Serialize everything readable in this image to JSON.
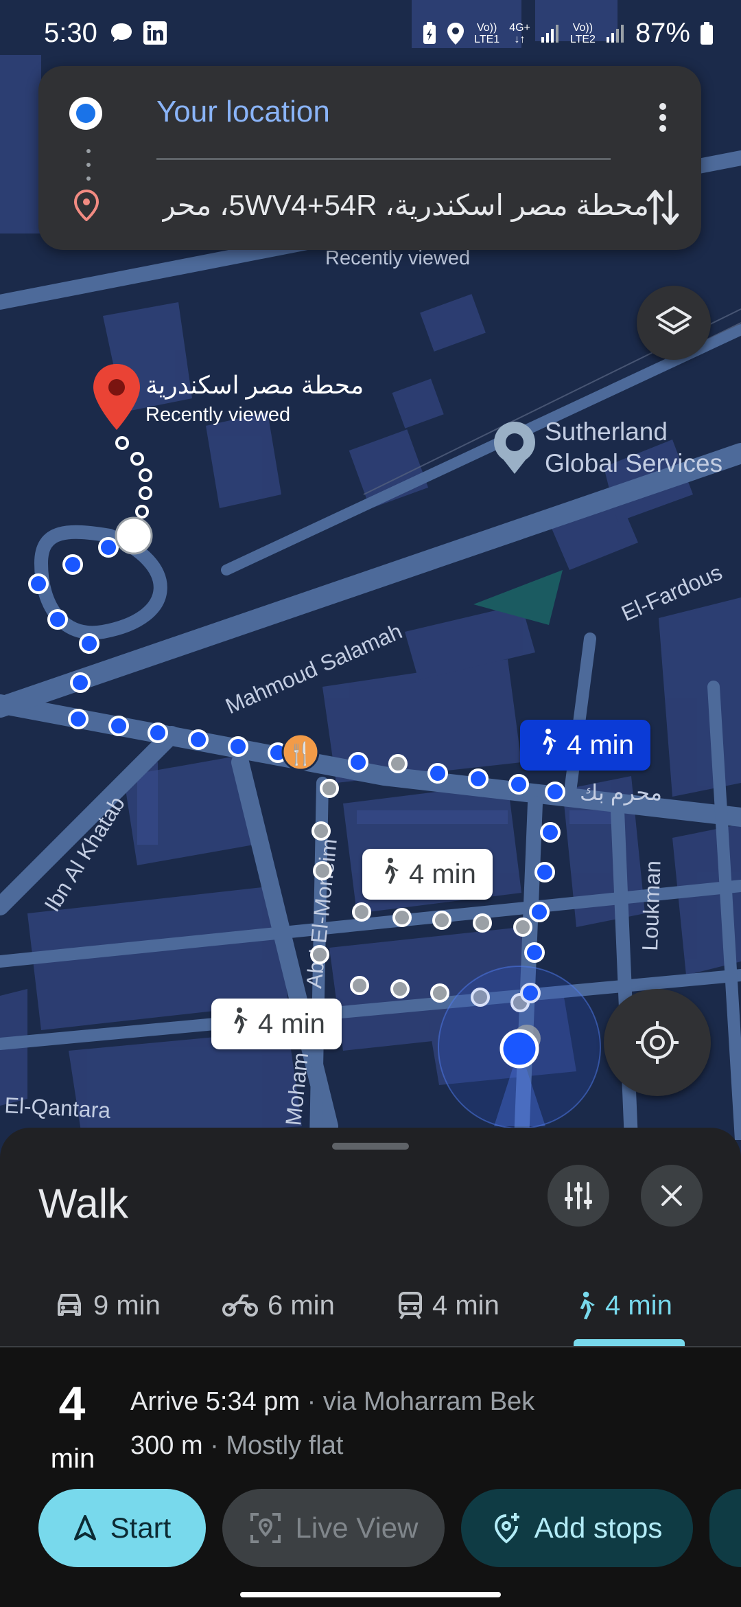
{
  "status_bar": {
    "time": "5:30",
    "net1_top": "Vo))",
    "net1_bottom": "LTE1",
    "net_type_top": "4G+",
    "net_type_bottom": "↓↑",
    "net2_top": "Vo))",
    "net2_bottom": "LTE2",
    "battery": "87%"
  },
  "directions_card": {
    "origin": "Your location",
    "destination": "محطة مصر اسكندرية، 5WV4+54R، محر..."
  },
  "map": {
    "places": [
      {
        "name": "محطة مصر اسكندرية",
        "sub": "Recently viewed"
      },
      {
        "name_line1": "Sutherland",
        "name_line2": "Global Services"
      }
    ],
    "faded_label": "Recently viewed",
    "streets": [
      "Mahmoud Salamah",
      "El-Fardous",
      "Ibn Al Khatab",
      "محرم بك",
      "Abd El-Moneim",
      "Loukman",
      "El-Qantara",
      "Moham"
    ],
    "route_chips": [
      {
        "label": "4 min",
        "active": true
      },
      {
        "label": "4 min",
        "active": false
      },
      {
        "label": "4 min",
        "active": false
      }
    ]
  },
  "sheet": {
    "title": "Walk",
    "modes": [
      {
        "icon": "car-icon",
        "label": "9 min"
      },
      {
        "icon": "motorcycle-icon",
        "label": "6 min"
      },
      {
        "icon": "transit-icon",
        "label": "4 min"
      },
      {
        "icon": "walk-icon",
        "label": "4 min",
        "selected": true
      }
    ],
    "duration_value": "4",
    "duration_unit": "min",
    "arrive_text": "Arrive 5:34 pm",
    "via_text": " · via Moharram Bek",
    "distance_text": "300 m",
    "terrain_text": " · Mostly flat",
    "actions": {
      "start": "Start",
      "live_view": "Live View",
      "add_stops": "Add stops"
    }
  },
  "colors": {
    "accent_blue": "#8ab4f8",
    "route_blue": "#1a57ff",
    "teal": "#78d9ec",
    "map_bg": "#1b2a4a"
  }
}
